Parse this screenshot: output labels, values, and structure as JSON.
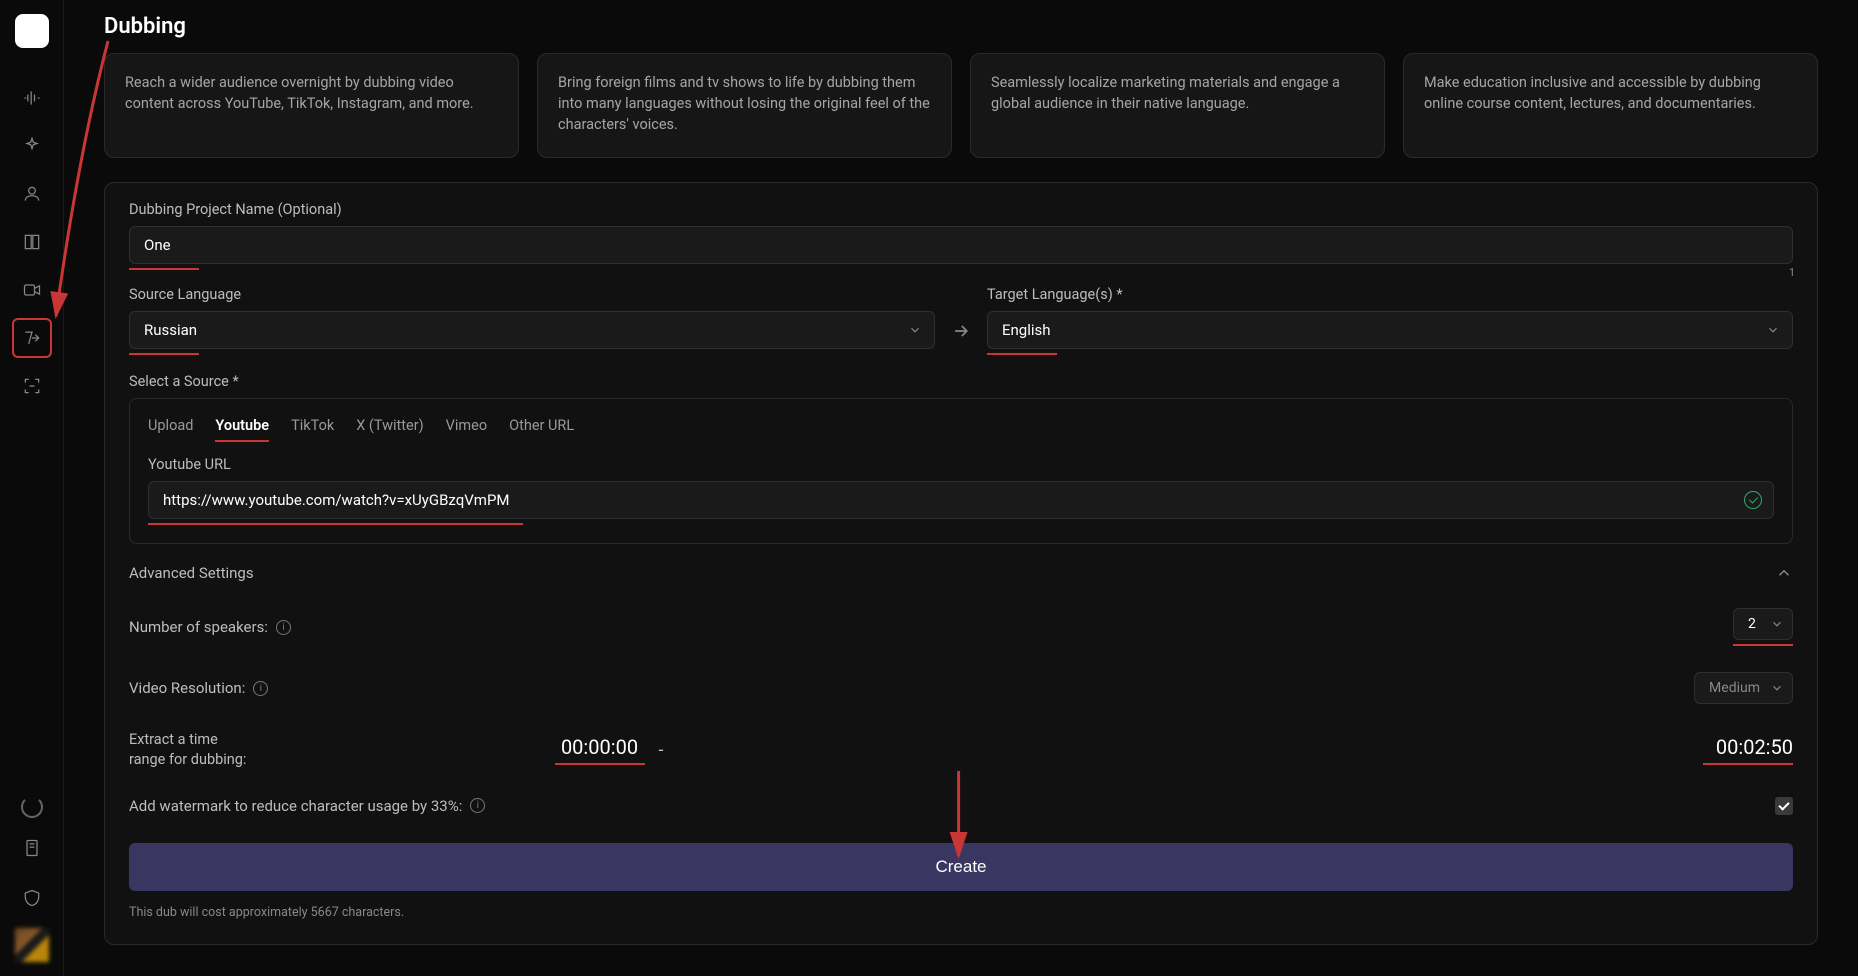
{
  "page_title": "Dubbing",
  "cards": [
    "Reach a wider audience overnight by dubbing video content across YouTube, TikTok, Instagram, and more.",
    "Bring foreign films and tv shows to life by dubbing them into many languages without losing the original feel of the characters' voices.",
    "Seamlessly localize marketing materials and engage a global audience in their native language.",
    "Make education inclusive and accessible by dubbing online course content, lectures, and documentaries."
  ],
  "form": {
    "project_name_label": "Dubbing Project Name (Optional)",
    "project_name_value": "One",
    "source_lang_label": "Source Language",
    "source_lang_value": "Russian",
    "target_lang_label": "Target Language(s) *",
    "target_lang_value": "English",
    "target_lang_count": "1",
    "source_label": "Select a Source *",
    "tabs": [
      "Upload",
      "Youtube",
      "TikTok",
      "X (Twitter)",
      "Vimeo",
      "Other URL"
    ],
    "active_tab": "Youtube",
    "url_label": "Youtube URL",
    "url_value": "https://www.youtube.com/watch?v=xUyGBzqVmPM",
    "advanced_label": "Advanced Settings",
    "speakers_label": "Number of speakers:",
    "speakers_value": "2",
    "resolution_label": "Video Resolution:",
    "resolution_value": "Medium",
    "time_label": "Extract a time range for dubbing:",
    "time_start": "00:00:00",
    "time_dash": "-",
    "time_end": "00:02:50",
    "watermark_label": "Add watermark to reduce character usage by 33%:",
    "watermark_checked": true,
    "create_label": "Create",
    "footnote": "This dub will cost approximately 5667 characters."
  }
}
